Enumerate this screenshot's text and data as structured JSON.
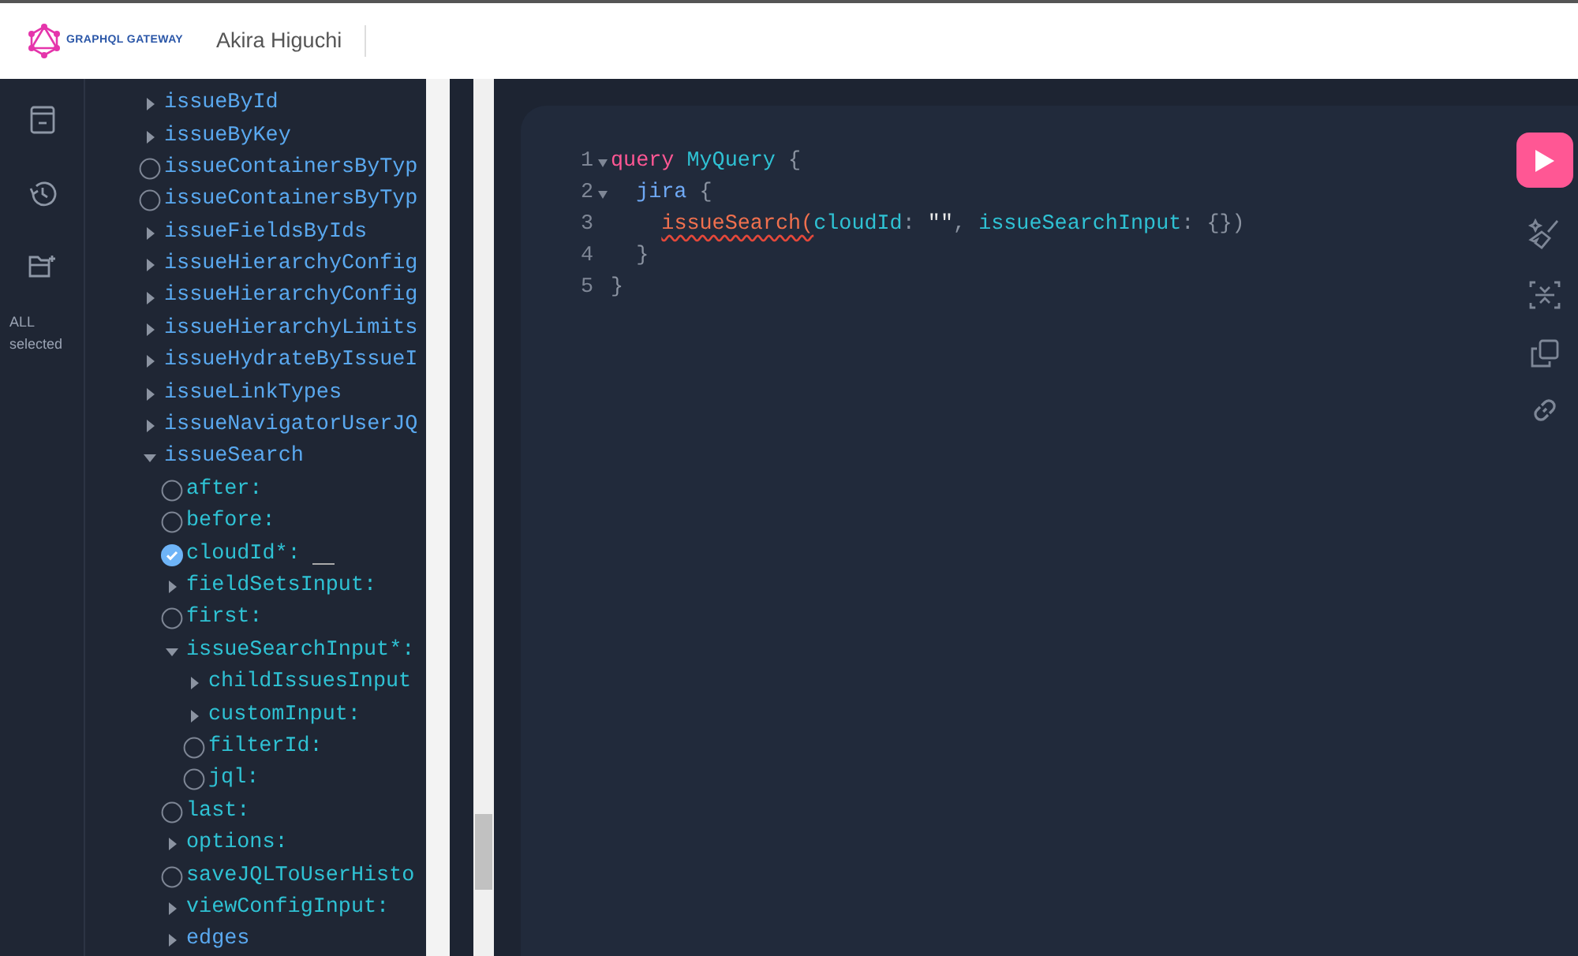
{
  "header": {
    "logo_text": "GRAPHQL GATEWAY",
    "user": "Akira Higuchi"
  },
  "sidebar": {
    "selection_label": "ALL selected"
  },
  "explorer": {
    "items": [
      {
        "label": "issueById",
        "kind": "field",
        "expandable": true,
        "expanded": false
      },
      {
        "label": "issueByKey",
        "kind": "field",
        "expandable": true,
        "expanded": false
      },
      {
        "label": "issueContainersByTyp",
        "kind": "field",
        "expandable": false,
        "checked": false
      },
      {
        "label": "issueContainersByTyp",
        "kind": "field",
        "expandable": false,
        "checked": false
      },
      {
        "label": "issueFieldsByIds",
        "kind": "field",
        "expandable": true,
        "expanded": false
      },
      {
        "label": "issueHierarchyConfig",
        "kind": "field",
        "expandable": true,
        "expanded": false
      },
      {
        "label": "issueHierarchyConfig",
        "kind": "field",
        "expandable": true,
        "expanded": false
      },
      {
        "label": "issueHierarchyLimits",
        "kind": "field",
        "expandable": true,
        "expanded": false
      },
      {
        "label": "issueHydrateByIssueI",
        "kind": "field",
        "expandable": true,
        "expanded": false
      },
      {
        "label": "issueLinkTypes",
        "kind": "field",
        "expandable": true,
        "expanded": false
      },
      {
        "label": "issueNavigatorUserJQ",
        "kind": "field",
        "expandable": true,
        "expanded": false
      },
      {
        "label": "issueSearch",
        "kind": "field",
        "expandable": true,
        "expanded": true,
        "children": [
          {
            "label": "after:",
            "kind": "argument",
            "expandable": false,
            "checked": false
          },
          {
            "label": "before:",
            "kind": "argument",
            "expandable": false,
            "checked": false
          },
          {
            "label": "cloudId*:",
            "kind": "argument",
            "expandable": false,
            "checked": true
          },
          {
            "label": "fieldSetsInput:",
            "kind": "argument",
            "expandable": true,
            "expanded": false
          },
          {
            "label": "first:",
            "kind": "argument",
            "expandable": false,
            "checked": false
          },
          {
            "label": "issueSearchInput*:",
            "kind": "argument",
            "expandable": true,
            "expanded": true,
            "children": [
              {
                "label": "childIssuesInput",
                "kind": "argument",
                "expandable": true,
                "expanded": false
              },
              {
                "label": "customInput:",
                "kind": "argument",
                "expandable": true,
                "expanded": false
              },
              {
                "label": "filterId:",
                "kind": "argument",
                "expandable": false,
                "checked": false
              },
              {
                "label": "jql:",
                "kind": "argument",
                "expandable": false,
                "checked": false
              }
            ]
          },
          {
            "label": "last:",
            "kind": "argument",
            "expandable": false,
            "checked": false
          },
          {
            "label": "options:",
            "kind": "argument",
            "expandable": true,
            "expanded": false
          },
          {
            "label": "saveJQLToUserHisto",
            "kind": "argument",
            "expandable": false,
            "checked": false
          },
          {
            "label": "viewConfigInput:",
            "kind": "argument",
            "expandable": true,
            "expanded": false
          },
          {
            "label": "edges",
            "kind": "field",
            "expandable": true,
            "expanded": false
          }
        ]
      }
    ]
  },
  "editor": {
    "lines": [
      {
        "number": "1",
        "foldable": true,
        "tokens": [
          {
            "text": "query ",
            "kind": "keyword"
          },
          {
            "text": "MyQuery",
            "kind": "def"
          },
          {
            "text": " {",
            "kind": "punct"
          }
        ]
      },
      {
        "number": "2",
        "foldable": true,
        "tokens": [
          {
            "text": "  jira",
            "kind": "field"
          },
          {
            "text": " {",
            "kind": "punct"
          }
        ]
      },
      {
        "number": "3",
        "foldable": false,
        "tokens": [
          {
            "text": "    issueSearch(",
            "kind": "error"
          },
          {
            "text": "cloudId",
            "kind": "arg"
          },
          {
            "text": ": ",
            "kind": "punct"
          },
          {
            "text": "\"\"",
            "kind": "string"
          },
          {
            "text": ", ",
            "kind": "punct"
          },
          {
            "text": "issueSearchInput",
            "kind": "arg"
          },
          {
            "text": ": {})",
            "kind": "punct"
          }
        ]
      },
      {
        "number": "4",
        "foldable": false,
        "tokens": [
          {
            "text": "  }",
            "kind": "punct"
          }
        ]
      },
      {
        "number": "5",
        "foldable": false,
        "tokens": [
          {
            "text": "}",
            "kind": "punct"
          }
        ]
      }
    ]
  }
}
